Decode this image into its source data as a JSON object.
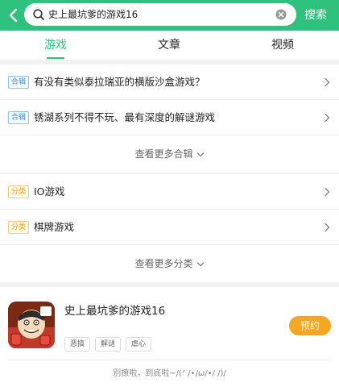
{
  "header": {
    "search_value": "史上最坑爹的游戏16",
    "search_button": "搜索"
  },
  "tabs": [
    {
      "label": "游戏",
      "active": true
    },
    {
      "label": "文章",
      "active": false
    },
    {
      "label": "视频",
      "active": false
    }
  ],
  "collections": {
    "badge": "合辑",
    "items": [
      {
        "label": "有没有类似泰拉瑞亚的横版沙盒游戏？"
      },
      {
        "label": "锈湖系列不得不玩、最有深度的解谜游戏"
      }
    ],
    "more_label": "查看更多合辑"
  },
  "categories": {
    "badge": "分类",
    "items": [
      {
        "label": "IO游戏"
      },
      {
        "label": "棋牌游戏"
      }
    ],
    "more_label": "查看更多分类"
  },
  "game": {
    "title": "史上最坑爹的游戏16",
    "tags": [
      "恶搞",
      "解谜",
      "虐心"
    ],
    "action_label": "预约"
  },
  "footer": {
    "end_text": "别撩啦，到底啦~/(ᐟ /•/ω/•/ /)/"
  },
  "colors": {
    "brand_green": "#2ec27e",
    "action_orange": "#f5a623",
    "badge_blue": "#3d9ae8",
    "badge_orange": "#f0a020"
  }
}
